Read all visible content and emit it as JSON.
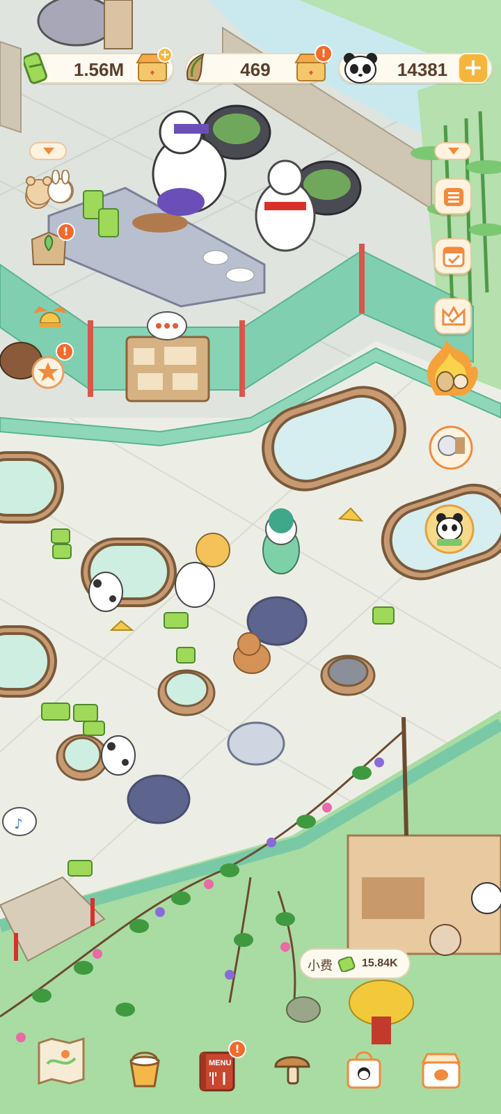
{
  "resources": {
    "bamboo_coins": "1.56M",
    "bamboo_shoots": "469",
    "panda_count": "14381"
  },
  "badges": {
    "alert": "!"
  },
  "tip": {
    "label": "小费",
    "value": "15.84K"
  },
  "bottom_menu": {
    "menu_label": "MENU"
  },
  "icons": {
    "bamboo_coin": "bamboo-coin-icon",
    "bamboo_shoot": "bamboo-shoot-icon",
    "panda_face": "panda-face-icon",
    "shop": "shop-icon",
    "plus": "plus-icon",
    "map": "map-icon",
    "paint_bucket": "paint-bucket-icon",
    "menu_book": "menu-book-icon",
    "mushroom": "mushroom-icon",
    "shopping_bag": "shopping-bag-icon",
    "treasure_box": "treasure-box-icon",
    "task_list": "task-list-icon",
    "calendar_check": "calendar-check-icon",
    "crown": "crown-icon",
    "music_event": "music-event-icon",
    "music_note": "music-note-icon"
  },
  "colors": {
    "alert": "#f26a2e",
    "accent": "#f6b63c",
    "grass": "#a9dca2",
    "floor": "#e9ece3"
  }
}
